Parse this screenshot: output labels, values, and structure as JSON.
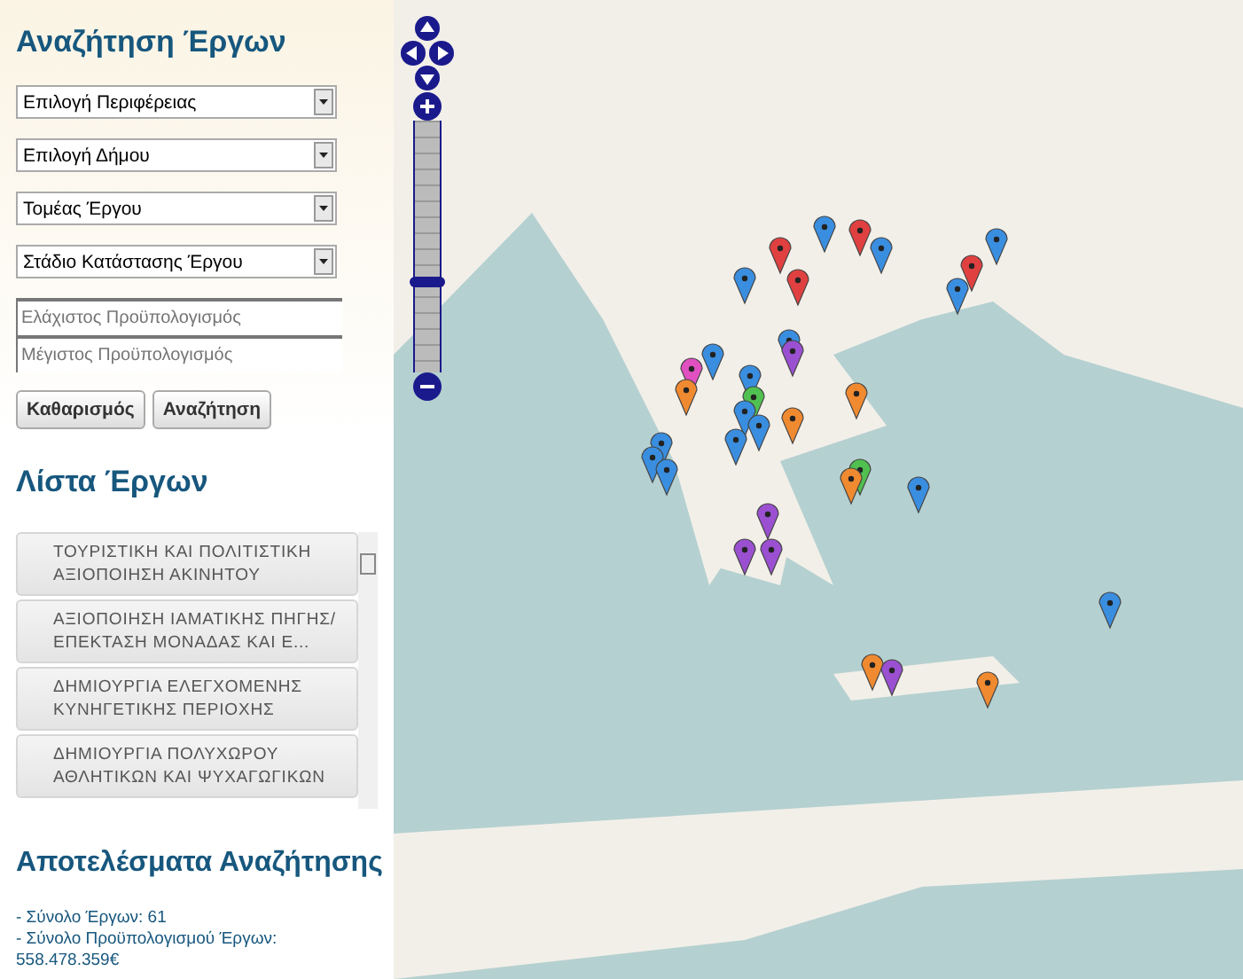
{
  "search": {
    "title": "Αναζήτηση Έργων",
    "dropdowns": [
      {
        "value": "Επιλογή Περιφέρειας"
      },
      {
        "value": "Επιλογή Δήμου"
      },
      {
        "value": "Τομέας Έργου"
      },
      {
        "value": "Στάδιο Κατάστασης Έργου"
      }
    ],
    "fields": [
      {
        "placeholder": "Ελάχιστος Προϋπολογισμός"
      },
      {
        "placeholder": "Μέγιστος Προϋπολογισμός"
      }
    ],
    "buttons": [
      "Καθαρισμός",
      "Αναζήτηση"
    ]
  },
  "project_list": {
    "title": "Λίστα Έργων",
    "items": [
      [
        "ΤΟΥΡΙΣΤΙΚΗ ΚΑΙ ΠΟΛΙΤΙΣΤΙΚΗ",
        "ΑΞΙΟΠΟΙΗΣΗ ΑΚΙΝΗΤΟΥ"
      ],
      [
        "ΑΞΙΟΠΟΙΗΣΗ ΙΑΜΑΤΙΚΗΣ ΠΗΓΗΣ/",
        "ΕΠΕΚΤΑΣΗ ΜΟΝΑΔΑΣ ΚΑΙ Ε..."
      ],
      [
        "ΔΗΜΙΟΥΡΓΙΑ ΕΛΕΓΧΟΜΕΝΗΣ",
        "ΚΥΝΗΓΕΤΙΚΗΣ ΠΕΡΙΟΧΗΣ"
      ],
      [
        "ΔΗΜΙΟΥΡΓΙΑ ΠΟΛΥΧΩΡΟΥ",
        "ΑΘΛΗΤΙΚΩΝ ΚΑΙ ΨΥΧΑΓΩΓΙΚΩΝ"
      ]
    ]
  },
  "results": {
    "title": "Αποτελέσματα Αναζήτησης",
    "lines": [
      "- Σύνολο Έργων: 61",
      "- Σύνολο Προϋπολογισμού Έργων:",
      "558.478.359€"
    ]
  },
  "map": {
    "zoom": {
      "level": 0.36
    }
  }
}
